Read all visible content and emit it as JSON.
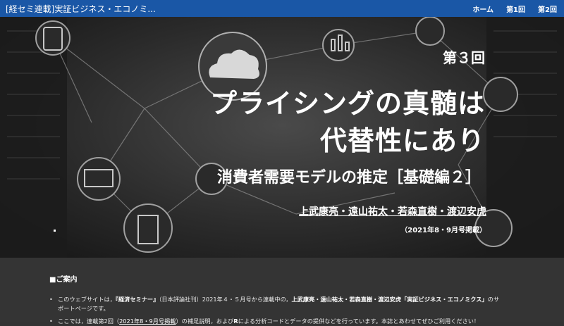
{
  "navbar": {
    "brand": "[経セミ連載]実証ビジネス・エコノミ...",
    "links": [
      "ホーム",
      "第1回",
      "第2回"
    ]
  },
  "hero": {
    "issue": "第３回",
    "title_line1": "プライシングの真髄は",
    "title_line2": "代替性にあり",
    "subtitle": "消費者需要モデルの推定［基礎編２］",
    "authors": "上武康亮・遠山祐太・若森直樹・渡辺安虎",
    "pubdate": "（2021年8・9月号掲載）"
  },
  "info": {
    "heading": "■ご案内",
    "item1": {
      "prefix": "このウェブサイトは，",
      "magazine": "『経済セミナー』",
      "middle": "（日本評論社刊）2021年４・５月号から連載中の，",
      "series": "上武康亮・遠山祐太・若森直樹・渡辺安虎「実証ビジネス・エコノミクス」",
      "suffix": "のサポートページです。"
    },
    "item2": {
      "prefix": "ここでは，連載第2回（",
      "link": "2021年8・9月号掲載",
      "middle": "）の補足説明，および",
      "r": "R",
      "suffix": "による分析コードとデータの提供などを行っています。本誌とあわせてぜひご利用ください！"
    }
  },
  "colors": {
    "navbar": "#1a57a6",
    "hero_bg": "#2b2b2b",
    "info_bg": "#343434"
  }
}
